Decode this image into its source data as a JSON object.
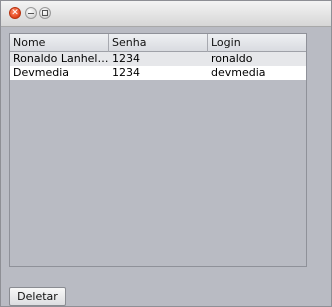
{
  "window": {
    "controls": [
      {
        "name": "close",
        "glyph": "✕"
      },
      {
        "name": "minimize",
        "glyph": ""
      },
      {
        "name": "maximize",
        "glyph": ""
      }
    ]
  },
  "table": {
    "columns": [
      "Nome",
      "Senha",
      "Login"
    ],
    "rows": [
      [
        "Ronaldo Lanhell...",
        "1234",
        "ronaldo"
      ],
      [
        "Devmedia",
        "1234",
        "devmedia"
      ]
    ]
  },
  "actions": {
    "delete_label": "Deletar"
  },
  "colors": {
    "window_bg": "#b9bbc3",
    "row_alt": "#e6e7ea",
    "row_white": "#ffffff"
  }
}
